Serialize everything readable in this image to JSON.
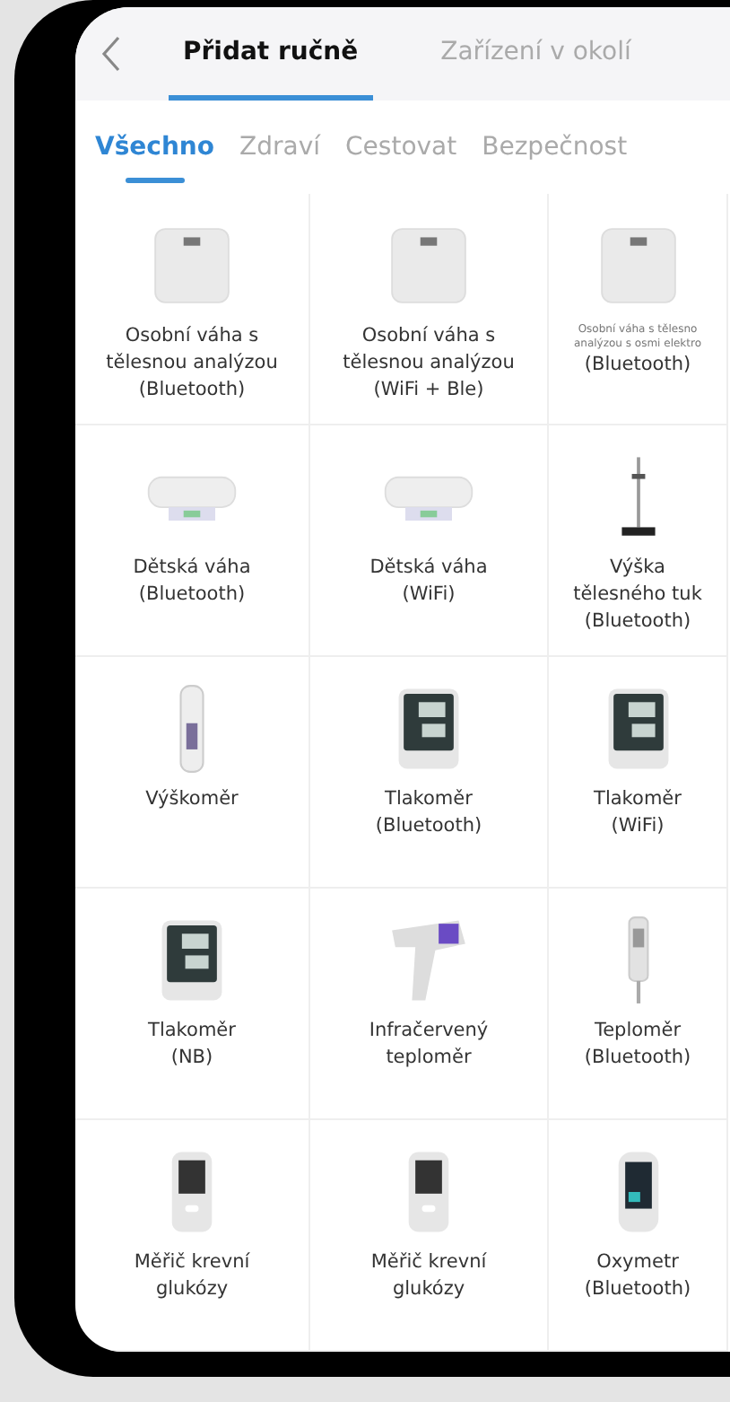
{
  "header": {
    "tabs": [
      {
        "label": "Přidat ručně",
        "selected": true
      },
      {
        "label": "Zařízení v okolí",
        "selected": false
      }
    ]
  },
  "categories": [
    {
      "label": "Všechno",
      "selected": true
    },
    {
      "label": "Zdraví",
      "selected": false
    },
    {
      "label": "Cestovat",
      "selected": false
    },
    {
      "label": "Bezpečnost",
      "selected": false
    }
  ],
  "devices": [
    {
      "kind": "scale",
      "lines": [
        "Osobní váha s",
        "tělesnou analýzou",
        "(Bluetooth)"
      ]
    },
    {
      "kind": "scale",
      "lines": [
        "Osobní váha s",
        "tělesnou analýzou",
        "(WiFi + Ble)"
      ]
    },
    {
      "kind": "scale",
      "lines": [
        "Osobní váha s tělesno",
        "analýzou s osmi elektro",
        "(Bluetooth)"
      ],
      "tiny": true
    },
    {
      "kind": "baby-scale",
      "lines": [
        "Dětská váha",
        "(Bluetooth)"
      ]
    },
    {
      "kind": "baby-scale",
      "lines": [
        "Dětská váha",
        "(WiFi)"
      ]
    },
    {
      "kind": "height-stand",
      "lines": [
        "Výška",
        "tělesného tuk",
        "(Bluetooth)"
      ]
    },
    {
      "kind": "height-meter",
      "lines": [
        "Výškoměr"
      ]
    },
    {
      "kind": "bp-monitor",
      "lines": [
        "Tlakoměr",
        "(Bluetooth)"
      ]
    },
    {
      "kind": "bp-monitor",
      "lines": [
        "Tlakoměr",
        "(WiFi)"
      ]
    },
    {
      "kind": "bp-monitor",
      "lines": [
        "Tlakoměr",
        "(NB)"
      ]
    },
    {
      "kind": "ir-thermometer",
      "lines": [
        "Infračervený",
        "teploměr"
      ]
    },
    {
      "kind": "stick-thermometer",
      "lines": [
        "Teploměr",
        "(Bluetooth)"
      ]
    },
    {
      "kind": "glucose-meter",
      "lines": [
        "Měřič krevní",
        "glukózy"
      ]
    },
    {
      "kind": "glucose-meter",
      "lines": [
        "Měřič krevní",
        "glukózy"
      ]
    },
    {
      "kind": "oximeter",
      "lines": [
        "Oxymetr",
        "(Bluetooth)"
      ]
    }
  ]
}
